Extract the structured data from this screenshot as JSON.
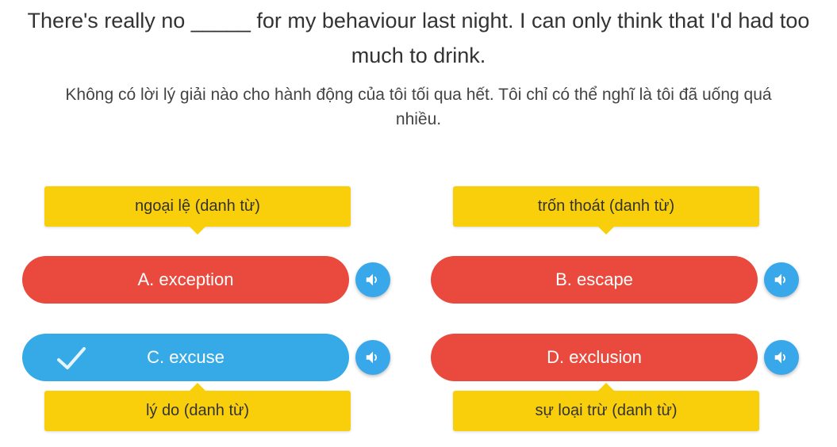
{
  "question": {
    "text": "There's really no _____ for my behaviour last night. I can only think that I'd had too much to drink.",
    "translation": "Không có lời lý giải nào cho hành động của tôi tối qua hết. Tôi chỉ có thể nghĩ là tôi đã uống quá nhiều."
  },
  "options": [
    {
      "label": "A. exception",
      "hint": "ngoại lệ (danh từ)",
      "status": "wrong",
      "selected": false
    },
    {
      "label": "B. escape",
      "hint": "trốn thoát (danh từ)",
      "status": "wrong",
      "selected": false
    },
    {
      "label": "C. excuse",
      "hint": "lý do (danh từ)",
      "status": "correct",
      "selected": true
    },
    {
      "label": "D. exclusion",
      "hint": "sự loại trừ (danh từ)",
      "status": "wrong",
      "selected": false
    }
  ],
  "icons": {
    "audio": "speaker-icon",
    "check": "checkmark-icon"
  },
  "colors": {
    "wrong": "#ea4a3d",
    "correct": "#35aae7",
    "hint": "#f9cf0b",
    "audio": "#38a8eb"
  }
}
